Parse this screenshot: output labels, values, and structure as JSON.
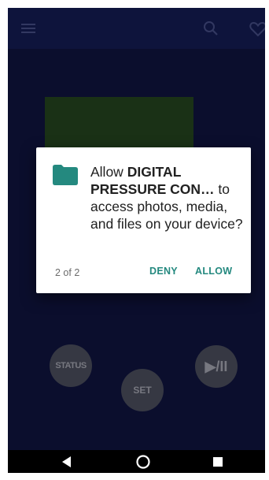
{
  "app_bar": {
    "menu_icon": "hamburger-menu-icon",
    "search_icon": "search-icon",
    "favorite_icon": "heart-icon"
  },
  "controls": {
    "status_label": "STATUS",
    "set_label": "SET",
    "play_pause_label": "▶/II"
  },
  "permission_dialog": {
    "icon": "folder-icon",
    "message_prefix": "Allow ",
    "app_name": "DIGITAL PRESSURE CON…",
    "message_suffix": " to access photos, media, and files on your device?",
    "counter": "2 of 2",
    "deny_label": "DENY",
    "allow_label": "ALLOW"
  },
  "nav_bar": {
    "back_icon": "back-triangle-icon",
    "home_icon": "home-circle-icon",
    "recents_icon": "recents-square-icon"
  },
  "colors": {
    "background": "#0d1136",
    "app_bar": "#111847",
    "accent": "#24897f",
    "control_button": "#40424f",
    "display_panel": "#1f3a1a"
  }
}
